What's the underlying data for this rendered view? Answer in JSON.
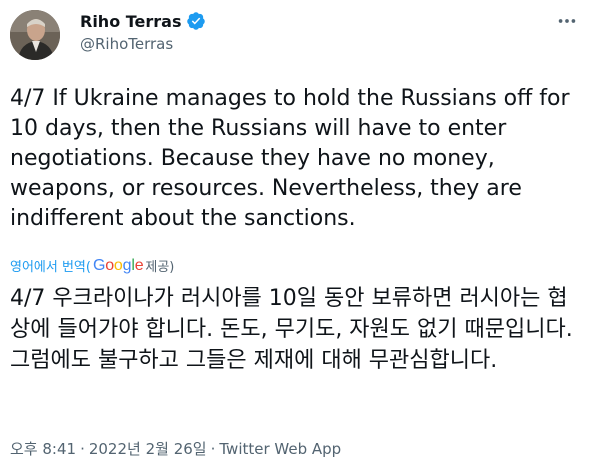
{
  "author": {
    "display_name": "Riho Terras",
    "handle": "@RihoTerras",
    "verified": true,
    "avatar_icon": "profile-photo"
  },
  "tweet": {
    "text": "4/7 If Ukraine manages to hold the Russians off for 10 days, then the Russians will have to enter negotiations. Because they have no money, weapons, or resources. Nevertheless, they are indifferent about the sanctions."
  },
  "translation": {
    "link_label": "영어에서 번역(",
    "provider": "Google",
    "provided_label": " 제공)",
    "text": "4/7 우크라이나가 러시아를 10일 동안 보류하면 러시아는 협상에 들어가야 합니다. 돈도, 무기도, 자원도 없기 때문입니다. 그럼에도 불구하고 그들은 제재에 대해 무관심합니다."
  },
  "meta": {
    "time": "오후 8:41",
    "separator": "·",
    "date": "2022년 2월 26일",
    "source": "Twitter Web App"
  },
  "colors": {
    "link": "#1d9bf0",
    "secondary_text": "#536471",
    "primary_text": "#0f1419",
    "verified": "#1d9bf0"
  },
  "icons": {
    "verified": "verified-badge-icon",
    "more": "more-options-icon"
  }
}
